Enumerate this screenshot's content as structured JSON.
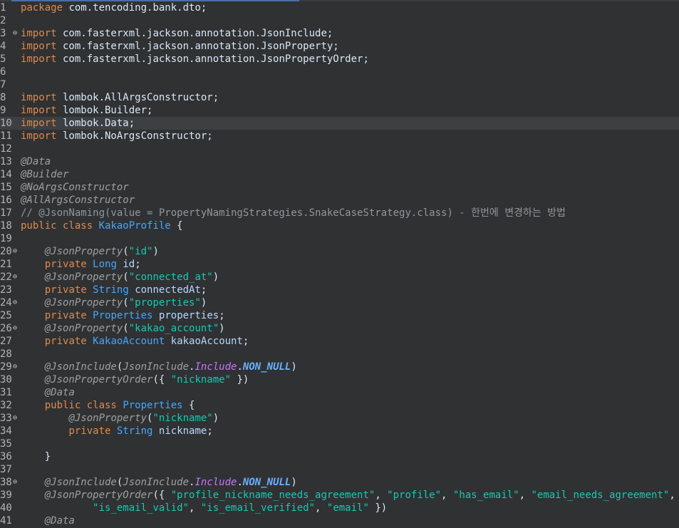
{
  "editor": {
    "current_line": 10,
    "fold_marker": "⊖",
    "lines": [
      {
        "n": "1",
        "fold": false,
        "tokens": [
          [
            "kw",
            "package"
          ],
          [
            "plain",
            " com.tencoding.bank.dto;"
          ]
        ]
      },
      {
        "n": "2",
        "fold": false,
        "tokens": []
      },
      {
        "n": "3",
        "fold": true,
        "tokens": [
          [
            "kw",
            "import"
          ],
          [
            "plain",
            " com.fasterxml.jackson.annotation.JsonInclude;"
          ]
        ]
      },
      {
        "n": "4",
        "fold": false,
        "tokens": [
          [
            "kw",
            "import"
          ],
          [
            "plain",
            " com.fasterxml.jackson.annotation.JsonProperty;"
          ]
        ]
      },
      {
        "n": "5",
        "fold": false,
        "tokens": [
          [
            "kw",
            "import"
          ],
          [
            "plain",
            " com.fasterxml.jackson.annotation.JsonPropertyOrder;"
          ]
        ]
      },
      {
        "n": "6",
        "fold": false,
        "tokens": []
      },
      {
        "n": "7",
        "fold": false,
        "tokens": []
      },
      {
        "n": "8",
        "fold": false,
        "tokens": [
          [
            "kw",
            "import"
          ],
          [
            "plain",
            " lombok.AllArgsConstructor;"
          ]
        ]
      },
      {
        "n": "9",
        "fold": false,
        "tokens": [
          [
            "kw",
            "import"
          ],
          [
            "plain",
            " lombok.Builder;"
          ]
        ]
      },
      {
        "n": "10",
        "fold": false,
        "tokens": [
          [
            "kw",
            "import"
          ],
          [
            "plain",
            " lombok.Data;"
          ]
        ]
      },
      {
        "n": "11",
        "fold": false,
        "tokens": [
          [
            "kw",
            "import"
          ],
          [
            "plain",
            " lombok.NoArgsConstructor;"
          ]
        ]
      },
      {
        "n": "12",
        "fold": false,
        "tokens": []
      },
      {
        "n": "13",
        "fold": false,
        "tokens": [
          [
            "ann",
            "@Data"
          ]
        ]
      },
      {
        "n": "14",
        "fold": false,
        "tokens": [
          [
            "ann",
            "@Builder"
          ]
        ]
      },
      {
        "n": "15",
        "fold": false,
        "tokens": [
          [
            "ann",
            "@NoArgsConstructor"
          ]
        ]
      },
      {
        "n": "16",
        "fold": false,
        "tokens": [
          [
            "ann",
            "@AllArgsConstructor"
          ]
        ]
      },
      {
        "n": "17",
        "fold": false,
        "tokens": [
          [
            "cmt",
            "// @JsonNaming(value = PropertyNamingStrategies.SnakeCaseStrategy.class) - 한번에 변경하는 방법"
          ]
        ]
      },
      {
        "n": "18",
        "fold": false,
        "tokens": [
          [
            "kw",
            "public class"
          ],
          [
            "plain",
            " "
          ],
          [
            "type",
            "KakaoProfile"
          ],
          [
            "plain",
            " {"
          ]
        ]
      },
      {
        "n": "19",
        "fold": false,
        "tokens": []
      },
      {
        "n": "20",
        "fold": true,
        "tokens": [
          [
            "plain",
            "    "
          ],
          [
            "ann",
            "@JsonProperty"
          ],
          [
            "plain",
            "("
          ],
          [
            "str",
            "\"id\""
          ],
          [
            "plain",
            ")"
          ]
        ]
      },
      {
        "n": "21",
        "fold": false,
        "tokens": [
          [
            "plain",
            "    "
          ],
          [
            "kw",
            "private"
          ],
          [
            "plain",
            " "
          ],
          [
            "type",
            "Long"
          ],
          [
            "plain",
            " "
          ],
          [
            "field",
            "id"
          ],
          [
            "plain",
            ";"
          ]
        ]
      },
      {
        "n": "22",
        "fold": true,
        "tokens": [
          [
            "plain",
            "    "
          ],
          [
            "ann",
            "@JsonProperty"
          ],
          [
            "plain",
            "("
          ],
          [
            "str",
            "\"connected_at\""
          ],
          [
            "plain",
            ")"
          ]
        ]
      },
      {
        "n": "23",
        "fold": false,
        "tokens": [
          [
            "plain",
            "    "
          ],
          [
            "kw",
            "private"
          ],
          [
            "plain",
            " "
          ],
          [
            "type",
            "String"
          ],
          [
            "plain",
            " "
          ],
          [
            "field",
            "connectedAt"
          ],
          [
            "plain",
            ";"
          ]
        ]
      },
      {
        "n": "24",
        "fold": true,
        "tokens": [
          [
            "plain",
            "    "
          ],
          [
            "ann",
            "@JsonProperty"
          ],
          [
            "plain",
            "("
          ],
          [
            "str",
            "\"properties\""
          ],
          [
            "plain",
            ")"
          ]
        ]
      },
      {
        "n": "25",
        "fold": false,
        "tokens": [
          [
            "plain",
            "    "
          ],
          [
            "kw",
            "private"
          ],
          [
            "plain",
            " "
          ],
          [
            "type",
            "Properties"
          ],
          [
            "plain",
            " "
          ],
          [
            "field",
            "properties"
          ],
          [
            "plain",
            ";"
          ]
        ]
      },
      {
        "n": "26",
        "fold": true,
        "tokens": [
          [
            "plain",
            "    "
          ],
          [
            "ann",
            "@JsonProperty"
          ],
          [
            "plain",
            "("
          ],
          [
            "str",
            "\"kakao_account\""
          ],
          [
            "plain",
            ")"
          ]
        ]
      },
      {
        "n": "27",
        "fold": false,
        "tokens": [
          [
            "plain",
            "    "
          ],
          [
            "kw",
            "private"
          ],
          [
            "plain",
            " "
          ],
          [
            "type",
            "KakaoAccount"
          ],
          [
            "plain",
            " "
          ],
          [
            "field",
            "kakaoAccount"
          ],
          [
            "plain",
            ";"
          ]
        ]
      },
      {
        "n": "28",
        "fold": false,
        "tokens": []
      },
      {
        "n": "29",
        "fold": true,
        "tokens": [
          [
            "plain",
            "    "
          ],
          [
            "ann",
            "@JsonInclude"
          ],
          [
            "plain",
            "("
          ],
          [
            "cls-it",
            "JsonInclude"
          ],
          [
            "plain",
            "."
          ],
          [
            "enum-it",
            "Include"
          ],
          [
            "plain",
            "."
          ],
          [
            "const",
            "NON_NULL"
          ],
          [
            "plain",
            ")"
          ]
        ]
      },
      {
        "n": "30",
        "fold": false,
        "tokens": [
          [
            "plain",
            "    "
          ],
          [
            "ann",
            "@JsonPropertyOrder"
          ],
          [
            "plain",
            "({ "
          ],
          [
            "str",
            "\"nickname\""
          ],
          [
            "plain",
            " })"
          ]
        ]
      },
      {
        "n": "31",
        "fold": false,
        "tokens": [
          [
            "plain",
            "    "
          ],
          [
            "ann",
            "@Data"
          ]
        ]
      },
      {
        "n": "32",
        "fold": false,
        "tokens": [
          [
            "plain",
            "    "
          ],
          [
            "kw",
            "public class"
          ],
          [
            "plain",
            " "
          ],
          [
            "type",
            "Properties"
          ],
          [
            "plain",
            " {"
          ]
        ]
      },
      {
        "n": "33",
        "fold": true,
        "tokens": [
          [
            "plain",
            "        "
          ],
          [
            "ann",
            "@JsonProperty"
          ],
          [
            "plain",
            "("
          ],
          [
            "str",
            "\"nickname\""
          ],
          [
            "plain",
            ")"
          ]
        ]
      },
      {
        "n": "34",
        "fold": false,
        "tokens": [
          [
            "plain",
            "        "
          ],
          [
            "kw",
            "private"
          ],
          [
            "plain",
            " "
          ],
          [
            "type",
            "String"
          ],
          [
            "plain",
            " "
          ],
          [
            "field",
            "nickname"
          ],
          [
            "plain",
            ";"
          ]
        ]
      },
      {
        "n": "35",
        "fold": false,
        "tokens": []
      },
      {
        "n": "36",
        "fold": false,
        "tokens": [
          [
            "plain",
            "    }"
          ]
        ]
      },
      {
        "n": "37",
        "fold": false,
        "tokens": []
      },
      {
        "n": "38",
        "fold": true,
        "tokens": [
          [
            "plain",
            "    "
          ],
          [
            "ann",
            "@JsonInclude"
          ],
          [
            "plain",
            "("
          ],
          [
            "cls-it",
            "JsonInclude"
          ],
          [
            "plain",
            "."
          ],
          [
            "enum-it",
            "Include"
          ],
          [
            "plain",
            "."
          ],
          [
            "const",
            "NON_NULL"
          ],
          [
            "plain",
            ")"
          ]
        ]
      },
      {
        "n": "39",
        "fold": false,
        "tokens": [
          [
            "plain",
            "    "
          ],
          [
            "ann",
            "@JsonPropertyOrder"
          ],
          [
            "plain",
            "({ "
          ],
          [
            "str",
            "\"profile_nickname_needs_agreement\""
          ],
          [
            "plain",
            ", "
          ],
          [
            "str",
            "\"profile\""
          ],
          [
            "plain",
            ", "
          ],
          [
            "str",
            "\"has_email\""
          ],
          [
            "plain",
            ", "
          ],
          [
            "str",
            "\"email_needs_agreement\""
          ],
          [
            "plain",
            ","
          ]
        ]
      },
      {
        "n": "40",
        "fold": false,
        "tokens": [
          [
            "plain",
            "            "
          ],
          [
            "str",
            "\"is_email_valid\""
          ],
          [
            "plain",
            ", "
          ],
          [
            "str",
            "\"is_email_verified\""
          ],
          [
            "plain",
            ", "
          ],
          [
            "str",
            "\"email\""
          ],
          [
            "plain",
            " })"
          ]
        ]
      },
      {
        "n": "41",
        "fold": false,
        "tokens": [
          [
            "plain",
            "    "
          ],
          [
            "ann",
            "@Data"
          ]
        ]
      }
    ]
  }
}
